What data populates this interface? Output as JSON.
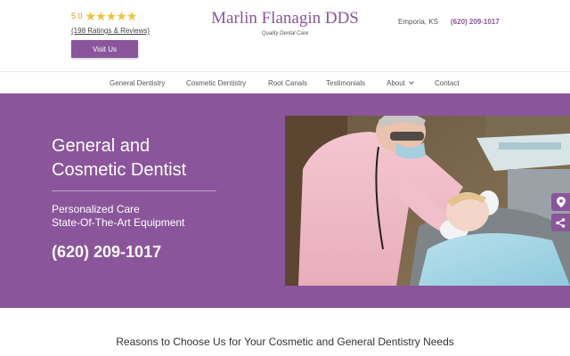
{
  "header": {
    "rating_score": "5.0",
    "stars": "★★★★★",
    "reviews_link": "(198 Ratings & Reviews)",
    "visit_button": "Visit Us",
    "brand_name": "Marlin Flanagin DDS",
    "brand_tagline": "Quality Dental Care",
    "city": "Emporia, KS",
    "phone": "(620) 209-1017"
  },
  "nav": {
    "items": [
      {
        "label": "General Dentistry"
      },
      {
        "label": "Cosmetic Dentistry"
      },
      {
        "label": "Root Canals"
      },
      {
        "label": "Testimonials"
      },
      {
        "label": "About"
      },
      {
        "label": "Contact"
      }
    ]
  },
  "hero": {
    "title_line1": "General and",
    "title_line2": "Cosmetic Dentist",
    "line1": "Personalized Care",
    "line2": "State-Of-The-Art Equipment",
    "phone": "(620) 209-1017"
  },
  "side_tabs": {
    "icons": [
      "map-pin-icon",
      "share-icon"
    ]
  },
  "section": {
    "title": "Reasons to Choose Us for Your Cosmetic and General Dentistry Needs"
  },
  "colors": {
    "brand": "#8b559b",
    "star": "#f0c23a"
  }
}
